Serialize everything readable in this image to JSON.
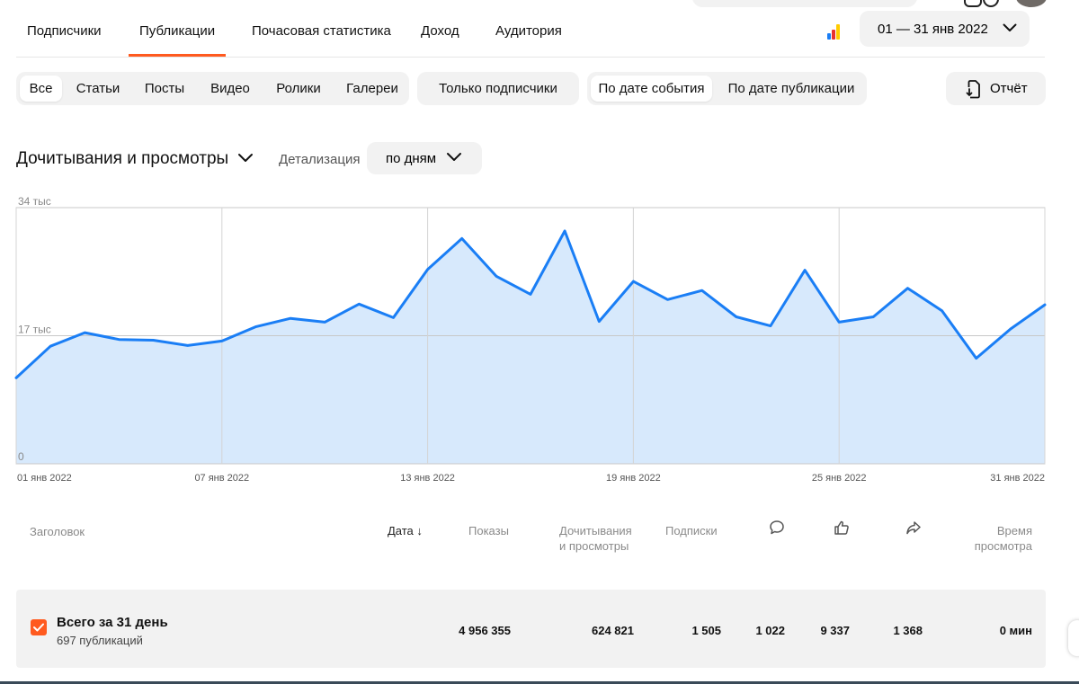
{
  "tabs": [
    {
      "label": "Подписчики"
    },
    {
      "label": "Публикации",
      "active": true
    },
    {
      "label": "Почасовая статистика"
    },
    {
      "label": "Доход"
    },
    {
      "label": "Аудитория"
    }
  ],
  "date_range": "01 — 31 янв 2022",
  "filters": {
    "types": [
      "Все",
      "Статьи",
      "Посты",
      "Видео",
      "Ролики",
      "Галереи"
    ],
    "selected_type": "Все",
    "subscribers_only": "Только подписчики",
    "date_modes": [
      "По дате события",
      "По дате публикации"
    ],
    "selected_date_mode": "По дате события"
  },
  "report_button": "Отчёт",
  "chart_header": {
    "metric": "Дочитывания и просмотры",
    "detail_label": "Детализация",
    "detail_value": "по дням"
  },
  "chart_data": {
    "type": "area",
    "y_tick_labels": [
      "34 тыс",
      "17 тыс",
      "0"
    ],
    "ylim": [
      0,
      34000
    ],
    "x_tick_labels": [
      "01 янв 2022",
      "07 янв 2022",
      "13 янв 2022",
      "19 янв 2022",
      "25 янв 2022",
      "31 янв 2022"
    ],
    "x": [
      "01 янв 2022",
      "02 янв 2022",
      "03 янв 2022",
      "04 янв 2022",
      "05 янв 2022",
      "06 янв 2022",
      "07 янв 2022",
      "08 янв 2022",
      "09 янв 2022",
      "10 янв 2022",
      "11 янв 2022",
      "12 янв 2022",
      "13 янв 2022",
      "14 янв 2022",
      "15 янв 2022",
      "16 янв 2022",
      "17 янв 2022",
      "18 янв 2022",
      "19 янв 2022",
      "20 янв 2022",
      "21 янв 2022",
      "22 янв 2022",
      "23 янв 2022",
      "24 янв 2022",
      "25 янв 2022",
      "26 янв 2022",
      "27 янв 2022",
      "28 янв 2022",
      "29 янв 2022",
      "30 янв 2022",
      "31 янв 2022"
    ],
    "values": [
      11400,
      15600,
      17400,
      16500,
      16400,
      15700,
      16300,
      18200,
      19300,
      18800,
      21200,
      19400,
      25800,
      29900,
      24900,
      22500,
      30900,
      18900,
      24200,
      21800,
      23000,
      19500,
      18300,
      25700,
      18800,
      19500,
      23300,
      20300,
      14000,
      17900,
      21100
    ],
    "grid": true,
    "line_color": "#1a7ef5",
    "fill_color": "#d7e9fc"
  },
  "table": {
    "headers": {
      "title": "Заголовок",
      "date": "Дата",
      "shows": "Показы",
      "reads_line1": "Дочитывания",
      "reads_line2": "и просмотры",
      "subs": "Подписки",
      "comments_icon": "comment-icon",
      "likes_icon": "like-icon",
      "shares_icon": "share-icon",
      "time_line1": "Время",
      "time_line2": "просмотра"
    },
    "total_row": {
      "title": "Всего за 31 день",
      "subtitle": "697 публикаций",
      "shows": "4 956 355",
      "reads": "624 821",
      "subs": "1 505",
      "comments": "1 022",
      "likes": "9 337",
      "shares": "1 368",
      "time": "0 мин"
    }
  },
  "colors": {
    "accent": "#ff5a1f",
    "chip_bg": "#f2f2f2"
  }
}
